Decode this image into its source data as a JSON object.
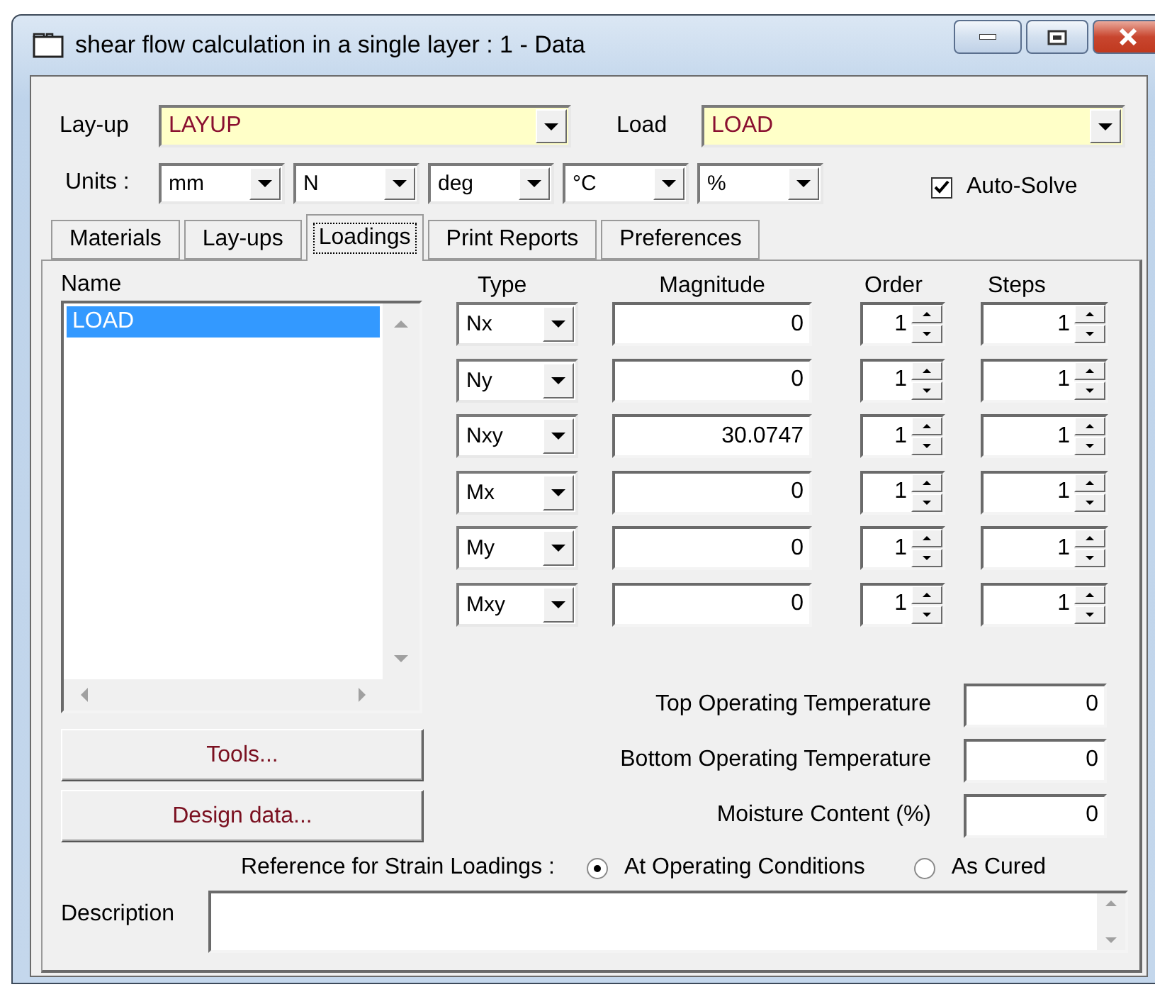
{
  "window": {
    "title": "shear flow calculation in a single layer : 1 - Data"
  },
  "layup": {
    "label": "Lay-up",
    "value": "LAYUP"
  },
  "load": {
    "label": "Load",
    "value": "LOAD"
  },
  "units": {
    "label": "Units :",
    "values": [
      "mm",
      "N",
      "deg",
      "°C",
      "%"
    ]
  },
  "auto_solve": {
    "label": "Auto-Solve",
    "checked": true
  },
  "tabs": [
    {
      "label": "Materials",
      "selected": false
    },
    {
      "label": "Lay-ups",
      "selected": false
    },
    {
      "label": "Loadings",
      "selected": true
    },
    {
      "label": "Print Reports",
      "selected": false
    },
    {
      "label": "Preferences",
      "selected": false
    }
  ],
  "loadings": {
    "name_label": "Name",
    "names": [
      {
        "text": "LOAD",
        "selected": true
      }
    ],
    "columns": [
      "Type",
      "Magnitude",
      "Order",
      "Steps"
    ],
    "rows": [
      {
        "type": "Nx",
        "magnitude": "0",
        "order": "1",
        "steps": "1"
      },
      {
        "type": "Ny",
        "magnitude": "0",
        "order": "1",
        "steps": "1"
      },
      {
        "type": "Nxy",
        "magnitude": "30.0747",
        "order": "1",
        "steps": "1"
      },
      {
        "type": "Mx",
        "magnitude": "0",
        "order": "1",
        "steps": "1"
      },
      {
        "type": "My",
        "magnitude": "0",
        "order": "1",
        "steps": "1"
      },
      {
        "type": "Mxy",
        "magnitude": "0",
        "order": "1",
        "steps": "1"
      }
    ]
  },
  "buttons": [
    "Tools...",
    "Design data..."
  ],
  "conditions": [
    {
      "label": "Top Operating Temperature",
      "value": "0"
    },
    {
      "label": "Bottom Operating Temperature",
      "value": "0"
    },
    {
      "label": "Moisture Content (%)",
      "value": "0"
    }
  ],
  "strain_reference": {
    "label": "Reference for Strain Loadings :",
    "options": [
      {
        "label": "At Operating Conditions",
        "selected": true
      },
      {
        "label": "As Cured",
        "selected": false
      }
    ]
  },
  "description": {
    "label": "Description"
  }
}
